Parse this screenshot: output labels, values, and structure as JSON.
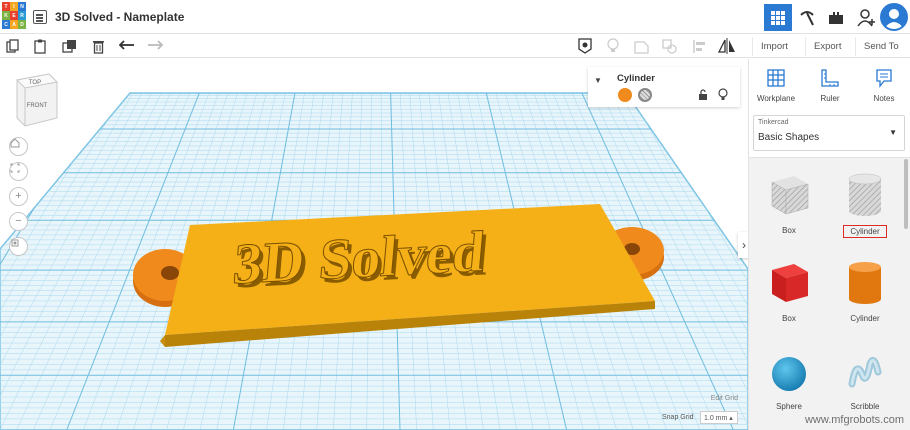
{
  "app": {
    "logo_letters": [
      "TIN",
      "KER",
      "CAD"
    ],
    "document_title": "3D Solved - Nameplate"
  },
  "header": {
    "buttons": [
      "3d-design-view",
      "circuits",
      "codeblocks",
      "add-user"
    ],
    "active_button": "3d-design-view"
  },
  "toolbar": {
    "import_label": "Import",
    "export_label": "Export",
    "send_to_label": "Send To"
  },
  "viewcube": {
    "top_label": "TOP",
    "front_label": "FRONT"
  },
  "inspector": {
    "title": "Cylinder",
    "solid_color": "#f08a1c",
    "hole_label": "hole"
  },
  "scene": {
    "plate_text": "3D Solved",
    "plate_color": "#f5b017",
    "cylinder_color": "#f08a1c",
    "grid_color": "#7cc4e3"
  },
  "grid": {
    "edit_grid_label": "Edit Grid",
    "snap_grid_label": "Snap Grid",
    "snap_value": "1.0 mm ▴"
  },
  "panel": {
    "tools": [
      {
        "label": "Workplane",
        "icon": "workplane-icon"
      },
      {
        "label": "Ruler",
        "icon": "ruler-icon"
      },
      {
        "label": "Notes",
        "icon": "notes-icon"
      }
    ],
    "library_category": "Tinkercad",
    "library_name": "Basic Shapes",
    "shapes": [
      {
        "label": "Box",
        "kind": "box-hole"
      },
      {
        "label": "Cylinder",
        "kind": "cylinder-hole",
        "highlighted": true
      },
      {
        "label": "Box",
        "kind": "box-solid"
      },
      {
        "label": "Cylinder",
        "kind": "cylinder-solid"
      },
      {
        "label": "Sphere",
        "kind": "sphere"
      },
      {
        "label": "Scribble",
        "kind": "scribble"
      }
    ]
  },
  "watermark": "www.mfgrobots.com"
}
